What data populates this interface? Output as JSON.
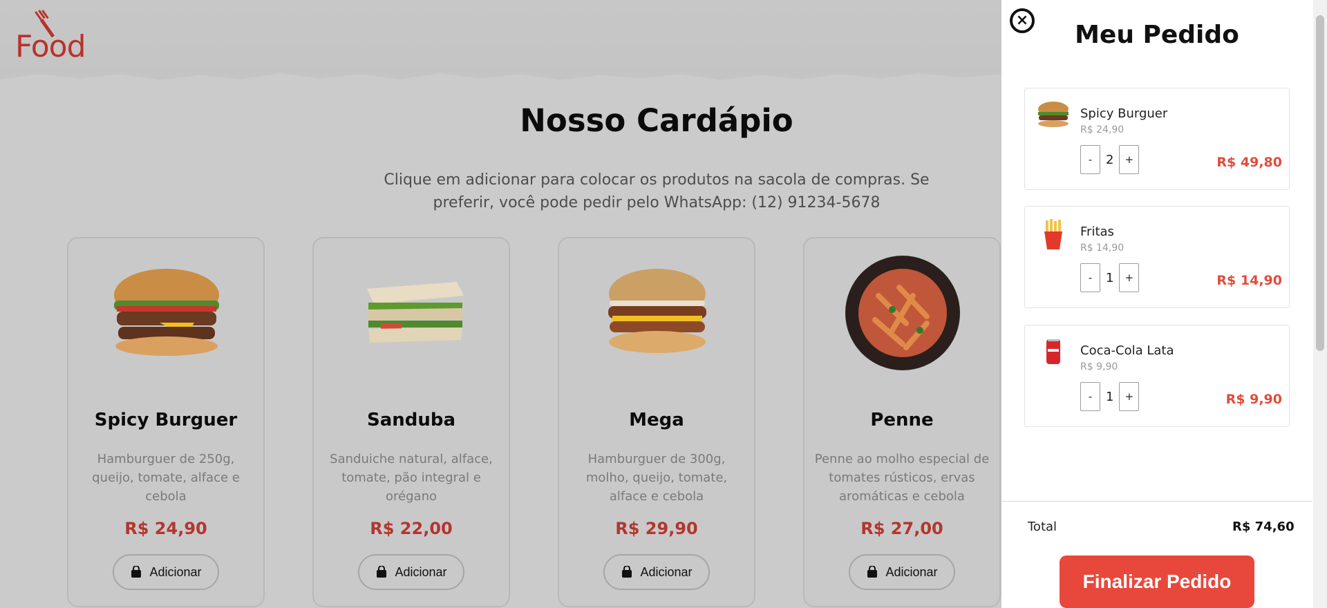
{
  "brand": {
    "logo_text": "Food"
  },
  "menu": {
    "title": "Nosso Cardápio",
    "subtitle": "Clique em adicionar para colocar os produtos na sacola de compras. Se preferir, você pode pedir pelo WhatsApp: (12) 91234-5678",
    "cards": [
      {
        "name": "Spicy Burguer",
        "desc": "Hamburguer de 250g, queijo, tomate, alface e cebola",
        "price": "R$ 24,90",
        "button": "Adicionar",
        "icon": "burger-icon"
      },
      {
        "name": "Sanduba",
        "desc": "Sanduiche natural, alface, tomate, pão integral e orégano",
        "price": "R$ 22,00",
        "button": "Adicionar",
        "icon": "sandwich-icon"
      },
      {
        "name": "Mega",
        "desc": "Hamburguer de 300g, molho, queijo, tomate, alface e cebola",
        "price": "R$ 29,90",
        "button": "Adicionar",
        "icon": "burger-icon"
      },
      {
        "name": "Penne",
        "desc": "Penne ao molho especial de tomates rústicos, ervas aromáticas e cebola",
        "price": "R$ 27,00",
        "button": "Adicionar",
        "icon": "pasta-icon"
      }
    ]
  },
  "cart": {
    "title": "Meu Pedido",
    "items": [
      {
        "name": "Spicy Burguer",
        "unit_price": "R$ 24,90",
        "qty": "2",
        "minus": "-",
        "plus": "+",
        "subtotal": "R$ 49,80",
        "icon": "burger-icon"
      },
      {
        "name": "Fritas",
        "unit_price": "R$ 14,90",
        "qty": "1",
        "minus": "-",
        "plus": "+",
        "subtotal": "R$ 14,90",
        "icon": "fries-icon"
      },
      {
        "name": "Coca-Cola Lata",
        "unit_price": "R$ 9,90",
        "qty": "1",
        "minus": "-",
        "plus": "+",
        "subtotal": "R$ 9,90",
        "icon": "soda-can-icon"
      }
    ],
    "total_label": "Total",
    "total_value": "R$ 74,60",
    "finalize_label": "Finalizar Pedido"
  },
  "colors": {
    "accent": "#e8483b",
    "price_dim": "#b3362f",
    "logo": "#b8322c"
  }
}
